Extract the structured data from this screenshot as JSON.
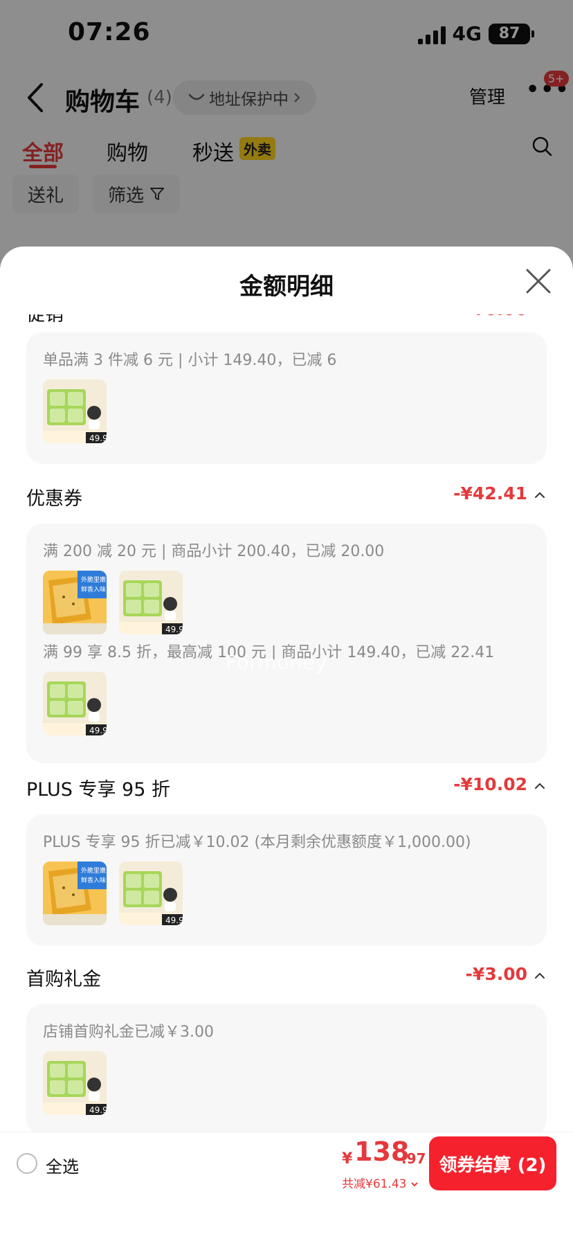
{
  "status_bar": {
    "time": "07:26",
    "network": "4G",
    "battery": "87"
  },
  "nav": {
    "title": "购物车",
    "count": "(4)",
    "address_protect": "地址保护中",
    "manage": "管理",
    "more_badge": "5+"
  },
  "tabs": [
    {
      "label": "全部",
      "active": true
    },
    {
      "label": "购物",
      "active": false
    },
    {
      "label": "秒送",
      "active": false
    }
  ],
  "takeout_tag": "外卖",
  "filters": [
    {
      "label": "送礼"
    },
    {
      "label": "筛选"
    }
  ],
  "sheet": {
    "title": "金额明细",
    "top_section": {
      "line": "单品满 3 件减 6 元 | 小计 149.40，已减 6"
    },
    "sections": [
      {
        "title": "优惠券",
        "amount": "-¥42.41",
        "lines": [
          "满 200 减 20 元 | 商品小计 200.40，已减 20.00",
          "满 99 享 8.5 折，最高减 100 元 | 商品小计 149.40，已减 22.41"
        ]
      },
      {
        "title": "PLUS 专享 95 折",
        "amount": "-¥10.02",
        "lines": [
          "PLUS 专享 95 折已减￥10.02 (本月剩余优惠额度￥1,000.00)"
        ]
      },
      {
        "title": "首购礼金",
        "amount": "-¥3.00",
        "lines": [
          "店铺首购礼金已减￥3.00"
        ]
      }
    ]
  },
  "bottom": {
    "select_all": "全选",
    "currency": "¥",
    "price_int": "138",
    "price_dec": ".97",
    "total_saved": "共减¥61.43",
    "checkout": "领券结算 (2)"
  },
  "colors": {
    "accent_red": "#e4393c",
    "checkout_red": "#f5222d",
    "takeout_yellow": "#ffd21c"
  }
}
